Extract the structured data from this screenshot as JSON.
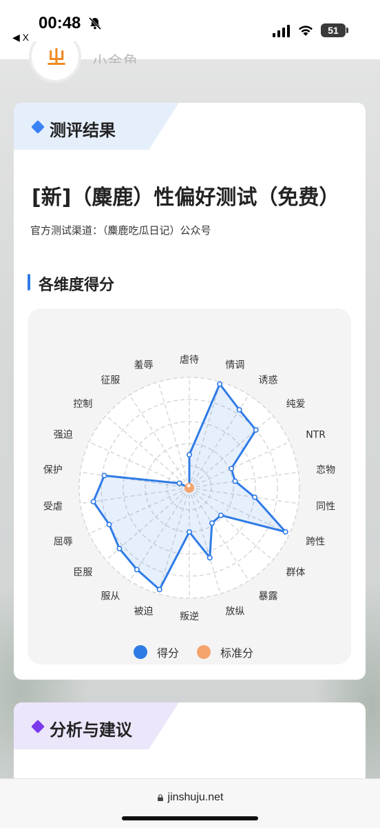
{
  "status_bar": {
    "time": "00:48",
    "back_app": "◀ X",
    "battery": "51"
  },
  "brand": {
    "name_fragment": "小金角",
    "avatar_mark": "ㄓ"
  },
  "result_card": {
    "title": "测评结果",
    "accent_color": "#3b82f6",
    "test_title": "[新]（麋鹿）性偏好测试（免费）",
    "channel": "官方测试渠道：（麋鹿吃瓜日记）公众号",
    "section_title": "各维度得分"
  },
  "analysis_card": {
    "title": "分析与建议",
    "accent_color": "#7c3aed"
  },
  "browser": {
    "url": "jinshuju.net"
  },
  "chart_data": {
    "type": "radar",
    "categories": [
      "虐待",
      "情调",
      "诱惑",
      "纯爱",
      "NTR",
      "恋物",
      "同性",
      "跨性",
      "群体",
      "暴露",
      "放纵",
      "叛逆",
      "被迫",
      "服从",
      "臣服",
      "屈辱",
      "受虐",
      "保护",
      "强迫",
      "控制",
      "征服",
      "羞辱"
    ],
    "series": [
      {
        "name": "得分",
        "color": "#2f7be6",
        "values": [
          30,
          98,
          84,
          80,
          42,
          42,
          60,
          96,
          38,
          38,
          66,
          40,
          96,
          88,
          84,
          80,
          88,
          78,
          10,
          0,
          0,
          0
        ]
      },
      {
        "name": "标准分",
        "color": "#f5a46e",
        "values": [
          2,
          2,
          2,
          2,
          2,
          2,
          2,
          2,
          2,
          2,
          2,
          2,
          2,
          2,
          2,
          2,
          2,
          2,
          2,
          2,
          2,
          2
        ]
      }
    ],
    "max": 100,
    "rings": 5,
    "legend_position": "bottom"
  }
}
